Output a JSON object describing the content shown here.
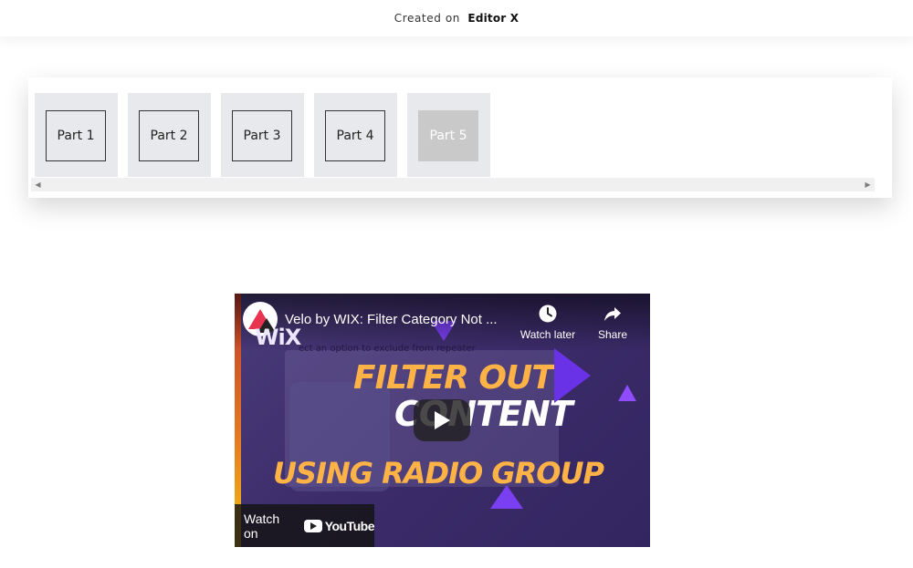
{
  "header": {
    "created_prefix": "Created on",
    "brand": "Editor X"
  },
  "repeater": {
    "items": [
      {
        "label": "Part 1",
        "disabled": false
      },
      {
        "label": "Part 2",
        "disabled": false
      },
      {
        "label": "Part 3",
        "disabled": false
      },
      {
        "label": "Part 4",
        "disabled": false
      },
      {
        "label": "Part 5",
        "disabled": true
      }
    ]
  },
  "video": {
    "title": "Velo by WIX: Filter Category Not ...",
    "channel_mark": "WiX",
    "subtext": "ect an option to exclude from repeater",
    "watch_later_label": "Watch later",
    "share_label": "Share",
    "headline_lines": [
      "FILTER OUT",
      "CONTENT",
      "USING RADIO GROUP"
    ],
    "watch_on_label": "Watch on",
    "youtube_label": "YouTube"
  },
  "icons": {
    "clock": "clock-icon",
    "share": "share-arrow-icon",
    "play": "play-icon",
    "youtube": "youtube-logo-icon"
  },
  "colors": {
    "disabled_button": "#c9c9c9",
    "tile_background": "#e8e9ec",
    "video_accent": "#ffb347"
  }
}
